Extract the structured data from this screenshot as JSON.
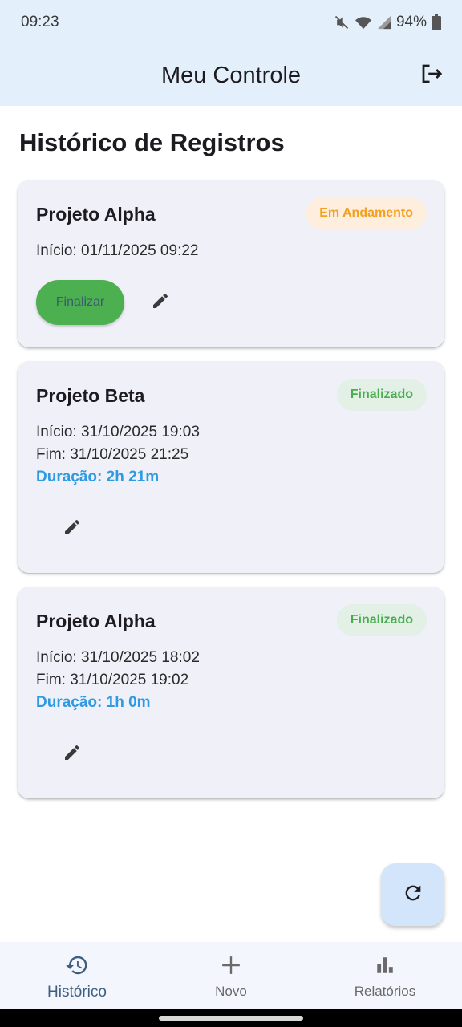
{
  "status_bar": {
    "time": "09:23",
    "battery": "94%"
  },
  "app_bar": {
    "title": "Meu Controle",
    "logout_icon": "logout-icon"
  },
  "page": {
    "heading": "Histórico de Registros"
  },
  "records": [
    {
      "title": "Projeto Alpha",
      "status": "Em Andamento",
      "start": "Início: 01/11/2025 09:22",
      "finish_label": "Finalizar"
    },
    {
      "title": "Projeto Beta",
      "status": "Finalizado",
      "start": "Início: 31/10/2025 19:03",
      "end": "Fim: 31/10/2025 21:25",
      "duration": "Duração: 2h 21m"
    },
    {
      "title": "Projeto Alpha",
      "status": "Finalizado",
      "start": "Início: 31/10/2025 18:02",
      "end": "Fim: 31/10/2025 19:02",
      "duration": "Duração: 1h 0m"
    }
  ],
  "fab": {
    "icon": "refresh-icon"
  },
  "bottom_nav": [
    {
      "label": "Histórico",
      "icon": "history-icon",
      "active": true
    },
    {
      "label": "Novo",
      "icon": "plus-icon",
      "active": false
    },
    {
      "label": "Relatórios",
      "icon": "bar-chart-icon",
      "active": false
    }
  ],
  "colors": {
    "app_bar_bg": "#e3f0fb",
    "card_bg": "#f0f0f8",
    "running_badge_bg": "#fdeedd",
    "running_badge_text": "#f5a020",
    "done_badge_bg": "#e3f0e5",
    "done_badge_text": "#47ad4f",
    "finish_button": "#4caf50",
    "duration_text": "#2d9ae2",
    "fab_bg": "#d3e5fb",
    "nav_active": "#3f5f82"
  }
}
